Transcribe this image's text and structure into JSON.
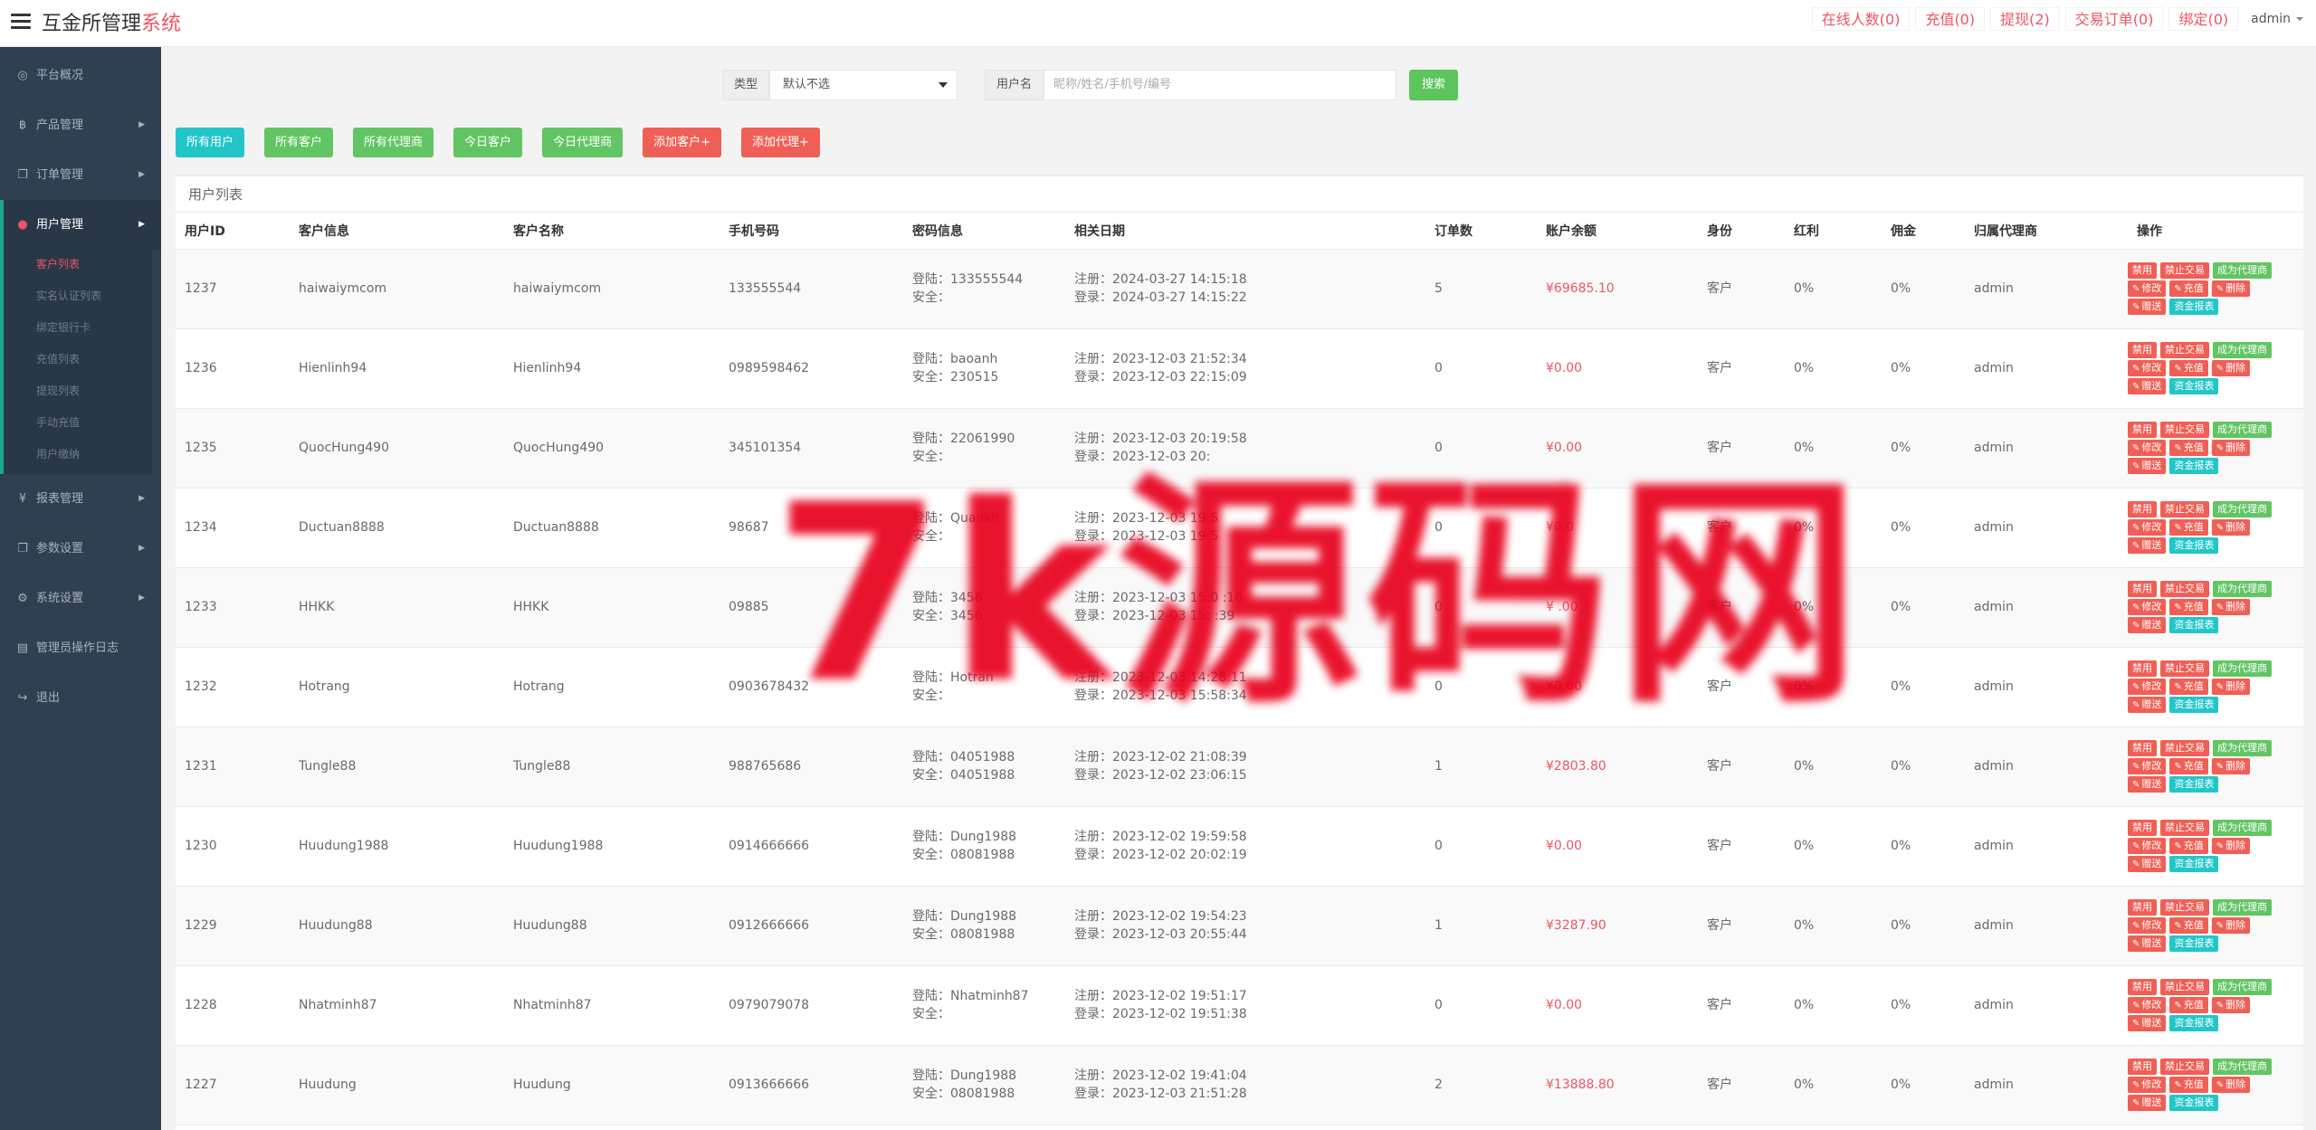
{
  "app": {
    "title": "互金所管理",
    "title_accent": "系统"
  },
  "topnav": {
    "online": "在线人数(0)",
    "recharge": "充值(0)",
    "withdraw": "提现(2)",
    "trade_orders": "交易订单(0)",
    "bind": "绑定(0)",
    "user": "admin"
  },
  "sidebar": {
    "items": [
      {
        "label": "平台概况",
        "icon": "dashboard-icon",
        "glyph": "◎"
      },
      {
        "label": "产品管理",
        "icon": "bitcoin-icon",
        "glyph": "฿"
      },
      {
        "label": "订单管理",
        "icon": "copy-icon",
        "glyph": "❐"
      },
      {
        "label": "用户管理",
        "icon": "user-icon",
        "glyph": "👤"
      },
      {
        "label": "报表管理",
        "icon": "yen-icon",
        "glyph": "¥"
      },
      {
        "label": "参数设置",
        "icon": "files-icon",
        "glyph": "❐"
      },
      {
        "label": "系统设置",
        "icon": "cogs-icon",
        "glyph": "⚙"
      },
      {
        "label": "管理员操作日志",
        "icon": "file-icon",
        "glyph": "▤"
      },
      {
        "label": "退出",
        "icon": "sign-out-icon",
        "glyph": "↪"
      }
    ],
    "subitems": [
      "客户列表",
      "实名认证列表",
      "绑定银行卡",
      "充值列表",
      "提现列表",
      "手动充值",
      "用户缴纳"
    ]
  },
  "search": {
    "type_label": "类型",
    "type_value": "默认不选",
    "user_label": "用户名",
    "user_placeholder": "昵称/姓名/手机号/编号",
    "search_button": "搜索"
  },
  "filters": [
    "所有用户",
    "所有客户",
    "所有代理商",
    "今日客户",
    "今日代理商",
    "添加客户+",
    "添加代理+"
  ],
  "table": {
    "title": "用户列表",
    "columns": [
      "用户ID",
      "客户信息",
      "客户名称",
      "手机号码",
      "密码信息",
      "相关日期",
      "订单数",
      "账户余额",
      "身份",
      "红利",
      "佣金",
      "归属代理商",
      "操作"
    ],
    "actions": {
      "disable": "禁用",
      "ban_trade": "禁止交易",
      "become_agent": "成为代理商",
      "edit": "修改",
      "recharge": "充值",
      "delete": "删除",
      "gift": "赠送",
      "fund_report": "资金报表"
    },
    "rows": [
      {
        "id": "1237",
        "info": "haiwaiymcom",
        "name": "haiwaiymcom",
        "phone": "133555544",
        "pwd_login": "登陆：133555544",
        "pwd_safe": "安全：",
        "reg": "注册：2024-03-27 14:15:18",
        "login": "登录：2024-03-27 14:15:22",
        "orders": "5",
        "balance": "¥69685.10",
        "role": "客户",
        "bonus": "0%",
        "commission": "0%",
        "agent": "admin"
      },
      {
        "id": "1236",
        "info": "Hienlinh94",
        "name": "Hienlinh94",
        "phone": "0989598462",
        "pwd_login": "登陆：baoanh",
        "pwd_safe": "安全：230515",
        "reg": "注册：2023-12-03 21:52:34",
        "login": "登录：2023-12-03 22:15:09",
        "orders": "0",
        "balance": "¥0.00",
        "role": "客户",
        "bonus": "0%",
        "commission": "0%",
        "agent": "admin"
      },
      {
        "id": "1235",
        "info": "QuocHung490",
        "name": "QuocHung490",
        "phone": "345101354",
        "pwd_login": "登陆：22061990",
        "pwd_safe": "安全：",
        "reg": "注册：2023-12-03 20:19:58",
        "login": "登录：2023-12-03 20:",
        "orders": "0",
        "balance": "¥0.00",
        "role": "客户",
        "bonus": "0%",
        "commission": "0%",
        "agent": "admin"
      },
      {
        "id": "1234",
        "info": "Ductuan8888",
        "name": "Ductuan8888",
        "phone": "98687",
        "pwd_login": "登陆：Quankh",
        "pwd_safe": "安全：",
        "reg": "注册：2023-12-03 19:5",
        "login": "登录：2023-12-03 19:5",
        "orders": "0",
        "balance": "¥0.0",
        "role": "客户",
        "bonus": "0%",
        "commission": "0%",
        "agent": "admin"
      },
      {
        "id": "1233",
        "info": "HHKK",
        "name": "HHKK",
        "phone": "09885",
        "pwd_login": "登陆：3456",
        "pwd_safe": "安全：3456",
        "reg": "注册：2023-12-03 15:0 :16",
        "login": "登录：2023-12-03 15: :39",
        "orders": "0",
        "balance": "¥ .00",
        "role": "客户",
        "bonus": "0%",
        "commission": "0%",
        "agent": "admin"
      },
      {
        "id": "1232",
        "info": "Hotrang",
        "name": "Hotrang",
        "phone": "0903678432",
        "pwd_login": "登陆：Hotran",
        "pwd_safe": "安全：",
        "reg": "注册：2023-12-03 14:28:11",
        "login": "登录：2023-12-03 15:58:34",
        "orders": "0",
        "balance": "¥0.00",
        "role": "客户",
        "bonus": "0%",
        "commission": "0%",
        "agent": "admin"
      },
      {
        "id": "1231",
        "info": "Tungle88",
        "name": "Tungle88",
        "phone": "988765686",
        "pwd_login": "登陆：04051988",
        "pwd_safe": "安全：04051988",
        "reg": "注册：2023-12-02 21:08:39",
        "login": "登录：2023-12-02 23:06:15",
        "orders": "1",
        "balance": "¥2803.80",
        "role": "客户",
        "bonus": "0%",
        "commission": "0%",
        "agent": "admin"
      },
      {
        "id": "1230",
        "info": "Huudung1988",
        "name": "Huudung1988",
        "phone": "0914666666",
        "pwd_login": "登陆：Dung1988",
        "pwd_safe": "安全：08081988",
        "reg": "注册：2023-12-02 19:59:58",
        "login": "登录：2023-12-02 20:02:19",
        "orders": "0",
        "balance": "¥0.00",
        "role": "客户",
        "bonus": "0%",
        "commission": "0%",
        "agent": "admin"
      },
      {
        "id": "1229",
        "info": "Huudung88",
        "name": "Huudung88",
        "phone": "0912666666",
        "pwd_login": "登陆：Dung1988",
        "pwd_safe": "安全：08081988",
        "reg": "注册：2023-12-02 19:54:23",
        "login": "登录：2023-12-03 20:55:44",
        "orders": "1",
        "balance": "¥3287.90",
        "role": "客户",
        "bonus": "0%",
        "commission": "0%",
        "agent": "admin"
      },
      {
        "id": "1228",
        "info": "Nhatminh87",
        "name": "Nhatminh87",
        "phone": "0979079078",
        "pwd_login": "登陆：Nhatminh87",
        "pwd_safe": "安全：",
        "reg": "注册：2023-12-02 19:51:17",
        "login": "登录：2023-12-02 19:51:38",
        "orders": "0",
        "balance": "¥0.00",
        "role": "客户",
        "bonus": "0%",
        "commission": "0%",
        "agent": "admin"
      },
      {
        "id": "1227",
        "info": "Huudung",
        "name": "Huudung",
        "phone": "0913666666",
        "pwd_login": "登陆：Dung1988",
        "pwd_safe": "安全：08081988",
        "reg": "注册：2023-12-02 19:41:04",
        "login": "登录：2023-12-03 21:51:28",
        "orders": "2",
        "balance": "¥13888.80",
        "role": "客户",
        "bonus": "0%",
        "commission": "0%",
        "agent": "admin"
      }
    ]
  },
  "watermark": "7k源码网"
}
